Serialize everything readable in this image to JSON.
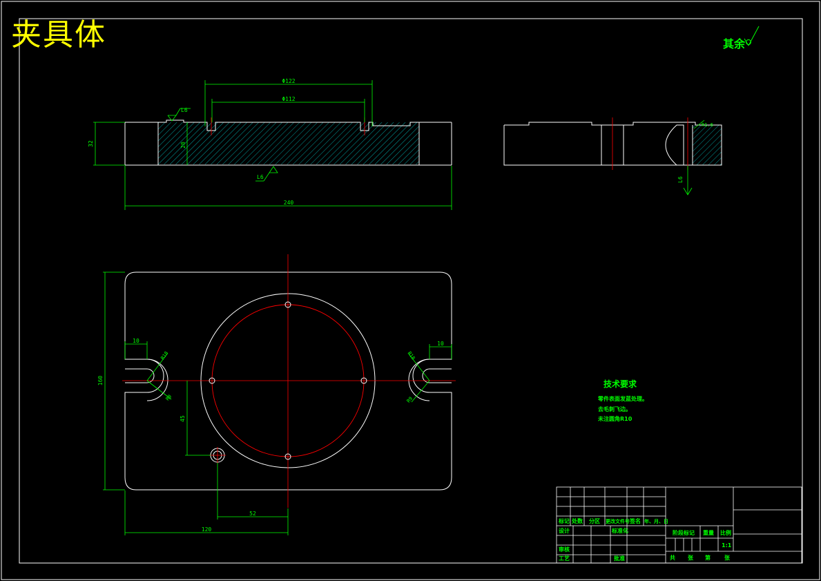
{
  "drawing": {
    "title": "夹具体",
    "roughness_note": "其余"
  },
  "dimensions": {
    "dia_122": "Φ122",
    "dia_112": "Φ112",
    "height_32": "32",
    "height_20": "20",
    "length_240": "240",
    "surface_l6_top": "L6",
    "surface_l6_bottom": "L6",
    "width_160": "160",
    "width_10_left": "10",
    "width_10_right": "10",
    "r18_left": "R18",
    "r9_left": "R9",
    "r18_right": "R18",
    "r9_right": "R9",
    "offset_45": "45",
    "offset_52": "52",
    "offset_120": "120",
    "side_l6": "L6",
    "side_r": "R1.6"
  },
  "tech": {
    "title": "技术要求",
    "lines": [
      "零件表面发蓝处理。",
      "去毛刺飞边。",
      "未注圆角R10"
    ]
  },
  "title_block": {
    "mark": "标记",
    "count": "处数",
    "zone": "分区",
    "doc_no": "更改文件号",
    "signature": "签名",
    "date": "年、月、日",
    "design": "设计",
    "standardization": "标准化",
    "stage_mark": "阶段标记",
    "weight": "重量",
    "scale": "比例",
    "scale_value": "1:1",
    "review": "审核",
    "process": "工艺",
    "approve": "批准",
    "total": "共",
    "sheet": "张",
    "no": "第",
    "sheet2": "张"
  }
}
